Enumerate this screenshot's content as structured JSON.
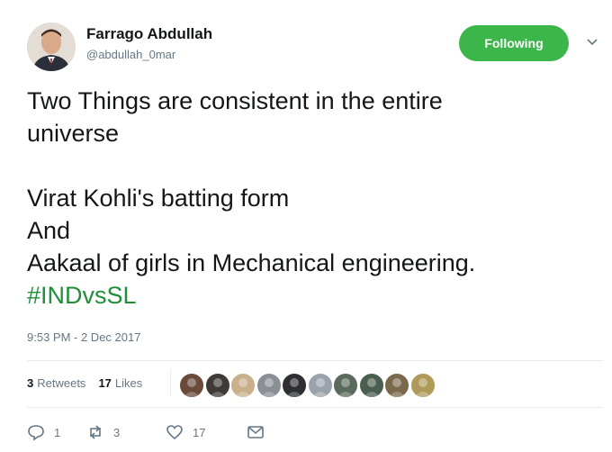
{
  "user": {
    "display_name": "Farrago Abdullah",
    "handle": "@abdullah_0mar"
  },
  "follow_button": {
    "label": "Following",
    "color": "#3cb64a"
  },
  "tweet": {
    "lines": [
      "Two Things are consistent in the entire",
      "universe",
      "",
      "Virat Kohli's batting form",
      "And",
      "Aakaal of girls in Mechanical engineering."
    ],
    "hashtag": "#INDvsSL",
    "timestamp": "9:53 PM - 2 Dec 2017"
  },
  "stats": {
    "retweets_count": "3",
    "retweets_label": "Retweets",
    "likes_count": "17",
    "likes_label": "Likes"
  },
  "actions": {
    "reply_count": "1",
    "retweet_count": "3",
    "like_count": "17"
  },
  "icons": [
    "chevron-down-icon",
    "reply-icon",
    "retweet-icon",
    "heart-icon",
    "mail-icon"
  ],
  "liker_avatar_colors": [
    "#6b4a3a",
    "#3d3a38",
    "#c9b08a",
    "#8a8f96",
    "#2e2f33",
    "#9aa3ab",
    "#5a6a5c",
    "#4b5d4e",
    "#7a6a4b",
    "#b09a5a"
  ]
}
